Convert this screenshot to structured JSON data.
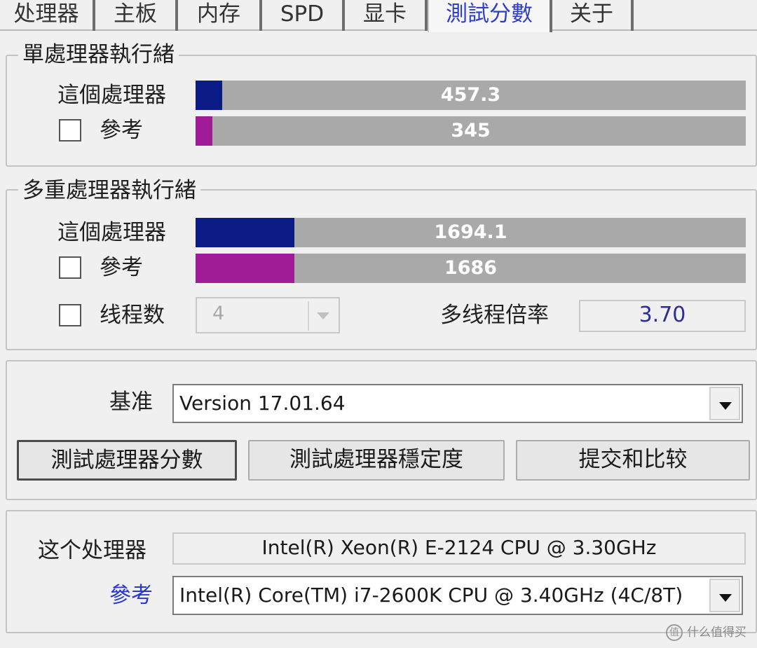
{
  "tabs": [
    {
      "label": "处理器"
    },
    {
      "label": "主板"
    },
    {
      "label": "内存"
    },
    {
      "label": "SPD"
    },
    {
      "label": "显卡"
    },
    {
      "label": "測試分數",
      "active": true
    },
    {
      "label": "关于"
    }
  ],
  "single_thread": {
    "legend": "單處理器執行緒",
    "this_label": "這個處理器",
    "this_value": "457.3",
    "this_fill_fraction": 0.049,
    "ref_label": "參考",
    "ref_value": "345",
    "ref_fill_fraction": 0.031,
    "ref_checked": false
  },
  "multi_thread": {
    "legend": "多重處理器執行緒",
    "this_label": "這個處理器",
    "this_value": "1694.1",
    "this_fill_fraction": 0.179,
    "ref_label": "參考",
    "ref_value": "1686",
    "ref_fill_fraction": 0.179,
    "ref_checked": false,
    "threads_label": "线程数",
    "threads_checked": false,
    "threads_value": "4",
    "ratio_label": "多线程倍率",
    "ratio_value": "3.70"
  },
  "benchmark": {
    "label": "基准",
    "version": "Version 17.01.64"
  },
  "buttons": {
    "bench_cpu": "測試處理器分數",
    "stress_cpu": "測試處理器穩定度",
    "submit": "提交和比较"
  },
  "processor_info": {
    "this_label": "这个处理器",
    "this_value": "Intel(R) Xeon(R) E-2124 CPU @ 3.30GHz",
    "ref_label": "參考",
    "ref_value": "Intel(R) Core(TM) i7-2600K CPU @ 3.40GHz (4C/8T)"
  },
  "watermark": {
    "text": "什么值得买",
    "icon": "值"
  },
  "colors": {
    "this_bar": "#0b1b86",
    "ref_bar": "#a21b96",
    "bar_bg": "#a9a9a9",
    "active_tab": "#2f3fc8",
    "ref_link": "#2b35d0",
    "ratio_value": "#2d2d9a"
  }
}
